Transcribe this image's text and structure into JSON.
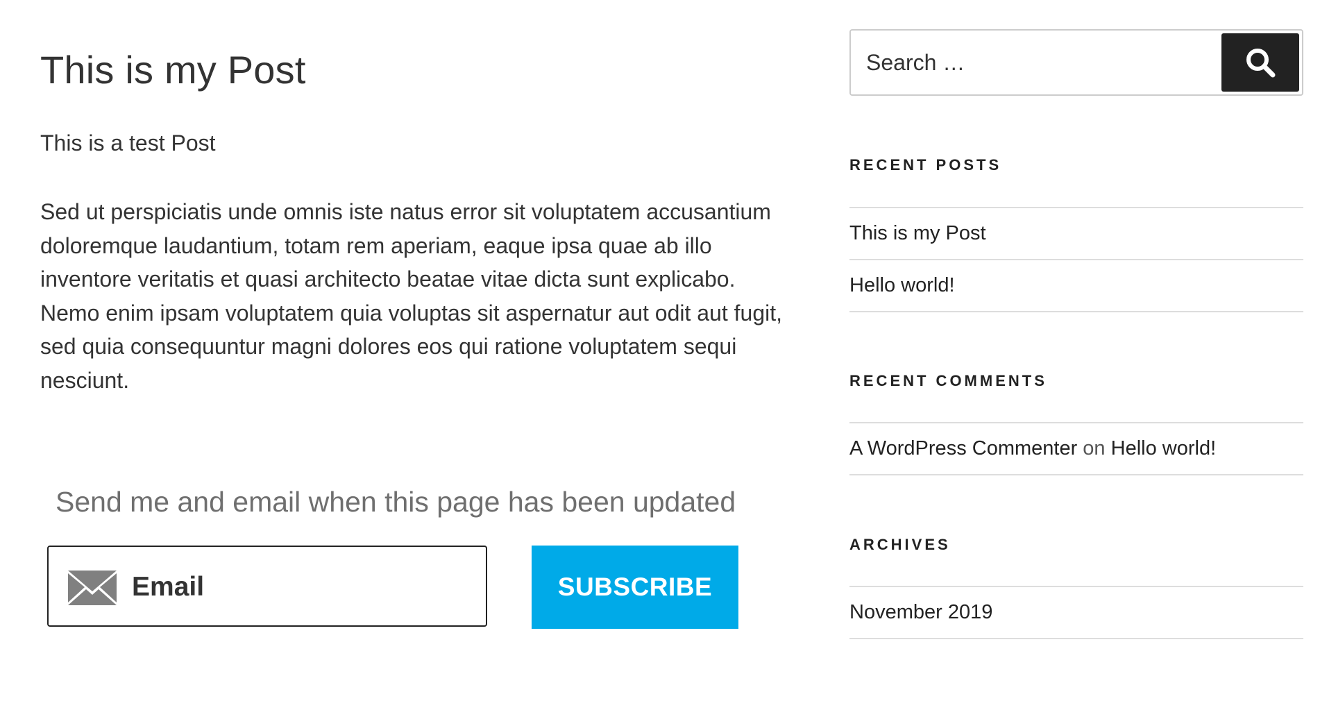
{
  "post": {
    "title": "This is my Post",
    "intro": "This is a test Post",
    "body": "Sed ut perspiciatis unde omnis iste natus error sit voluptatem accusantium doloremque laudantium, totam rem aperiam, eaque ipsa quae ab illo inventore veritatis et quasi architecto beatae vitae dicta sunt explicabo. Nemo enim ipsam voluptatem quia voluptas sit aspernatur aut odit aut fugit, sed quia consequuntur magni dolores eos qui ratione voluptatem sequi nesciunt."
  },
  "subscribe": {
    "heading": "Send me and email when this page has been updated",
    "email_placeholder": "Email",
    "button_label": "SUBSCRIBE",
    "button_color": "#00aae8",
    "icon": "envelope-icon"
  },
  "sidebar": {
    "search": {
      "placeholder": "Search …",
      "icon": "search-icon"
    },
    "recent_posts": {
      "title": "RECENT POSTS",
      "items": [
        {
          "label": "This is my Post"
        },
        {
          "label": "Hello world!"
        }
      ]
    },
    "recent_comments": {
      "title": "RECENT COMMENTS",
      "items": [
        {
          "author": "A WordPress Commenter",
          "on": "on",
          "post": "Hello world!"
        }
      ]
    },
    "archives": {
      "title": "ARCHIVES",
      "items": [
        {
          "label": "November 2019"
        }
      ]
    }
  }
}
